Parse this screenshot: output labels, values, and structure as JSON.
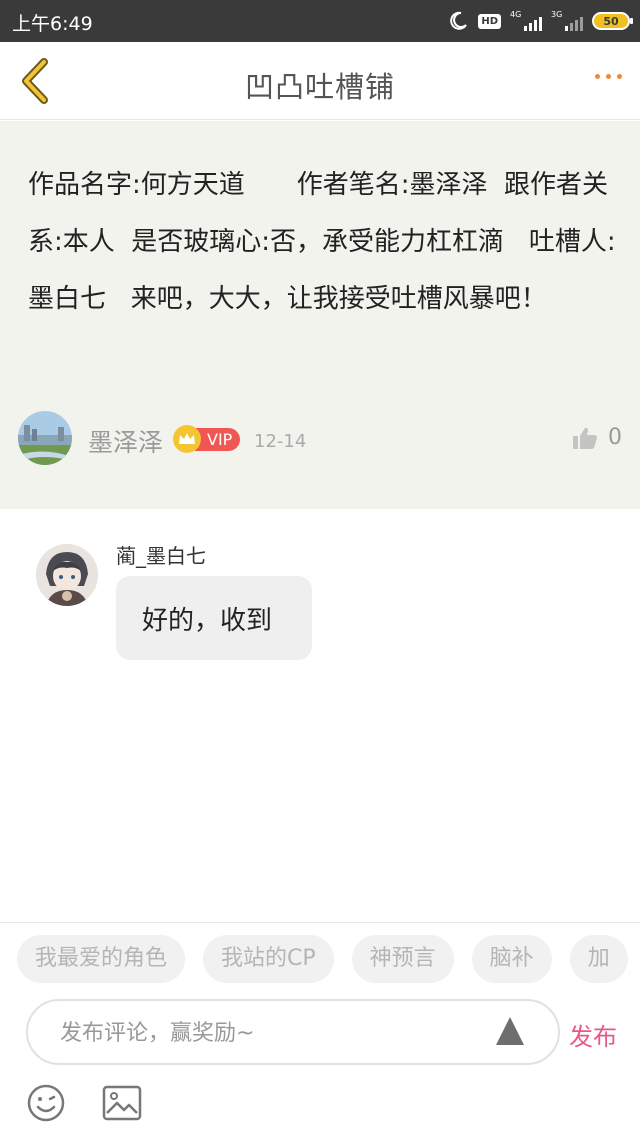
{
  "status_bar": {
    "time": "上午6:49",
    "hd": "HD",
    "net1": "4G",
    "net2": "3G",
    "battery": "50"
  },
  "header": {
    "title": "凹凸吐槽铺",
    "back_icon": "chevron-left-icon",
    "more_icon": "more-dots-icon"
  },
  "post": {
    "body": "作品名字:何方天道　　作者笔名:墨泽泽  跟作者关系:本人  是否玻璃心:否，承受能力杠杠滴   吐槽人:墨白七   来吧，大大，让我接受吐槽风暴吧！",
    "author": "墨泽泽",
    "vip_label": "VIP",
    "date": "12-14",
    "likes": "0"
  },
  "comments": [
    {
      "name": "蔺_墨白七",
      "text": "好的，收到"
    }
  ],
  "tags": [
    "我最爱的角色",
    "我站的CP",
    "神预言",
    "脑补",
    "加"
  ],
  "composer": {
    "placeholder": "发布评论，赢奖励~",
    "send_label": "发布"
  },
  "colors": {
    "accent": "#f08a3a",
    "send": "#e65a8a",
    "vip": "#f05654",
    "post_bg": "#f3f3ee"
  }
}
